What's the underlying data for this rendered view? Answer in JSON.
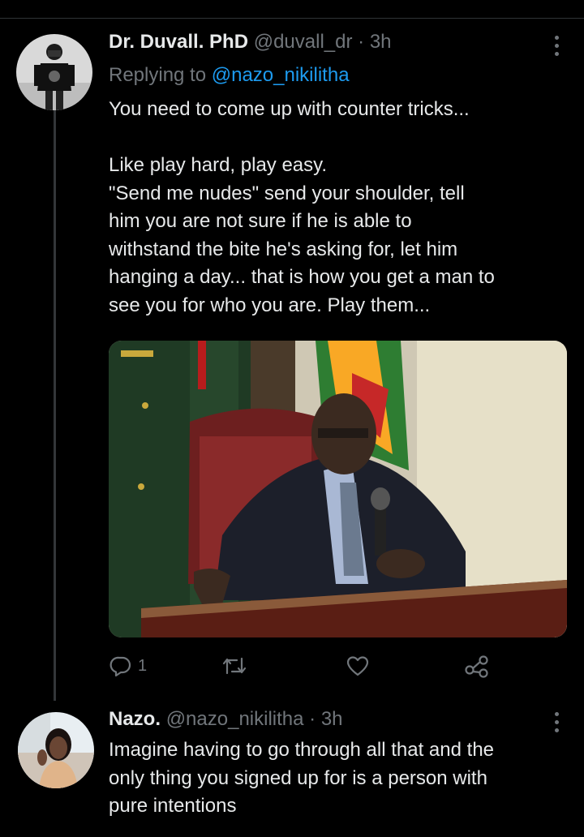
{
  "tweet1": {
    "display_name": "Dr. Duvall. PhD",
    "handle": "@duvall_dr",
    "time": "3h",
    "replying_prefix": "Replying to ",
    "replying_to": "@nazo_nikilitha",
    "lines": [
      "You need to come up with counter tricks...",
      "",
      "Like play hard, play easy.",
      "\"Send me nudes\" send your shoulder, tell",
      "him you are not sure if he is able to",
      "withstand the bite he's asking for, let him",
      "hanging a day... that is how you get a man to",
      "see you for who you are. Play them..."
    ],
    "reply_count": "1",
    "icons": [
      "reply-icon",
      "retweet-icon",
      "like-icon",
      "share-icon",
      "more-icon"
    ]
  },
  "tweet2": {
    "display_name": "Nazo.",
    "handle": "@nazo_nikilitha",
    "time": "3h",
    "lines": [
      "Imagine having to go through all that and the",
      "only thing you signed up for is a person with",
      "pure intentions"
    ]
  },
  "colors": {
    "background": "#000000",
    "text": "#e7e9ea",
    "muted": "#71767b",
    "accent": "#1d9bf0",
    "divider": "#2f3336"
  }
}
